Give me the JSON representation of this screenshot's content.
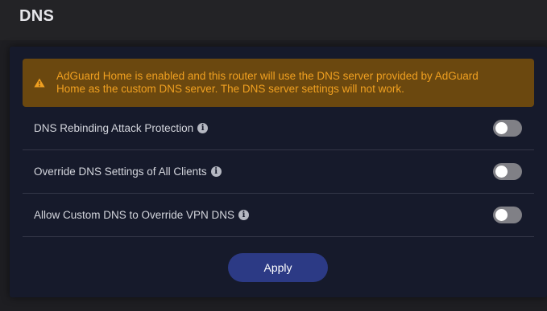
{
  "header": {
    "title": "DNS"
  },
  "alert": {
    "icon": "warning-icon",
    "text": "AdGuard Home is enabled and this router will use the DNS server provided by AdGuard Home as the custom DNS server. The DNS server settings will not work.",
    "text_color": "#f0a020",
    "background": "#6b480f"
  },
  "settings": [
    {
      "label": "DNS Rebinding Attack Protection",
      "enabled": false
    },
    {
      "label": "Override DNS Settings of All Clients",
      "enabled": false
    },
    {
      "label": "Allow Custom DNS to Override VPN DNS",
      "enabled": false
    }
  ],
  "info_icon_glyph": "i",
  "apply_button": {
    "label": "Apply",
    "color": "#2c3a85"
  }
}
